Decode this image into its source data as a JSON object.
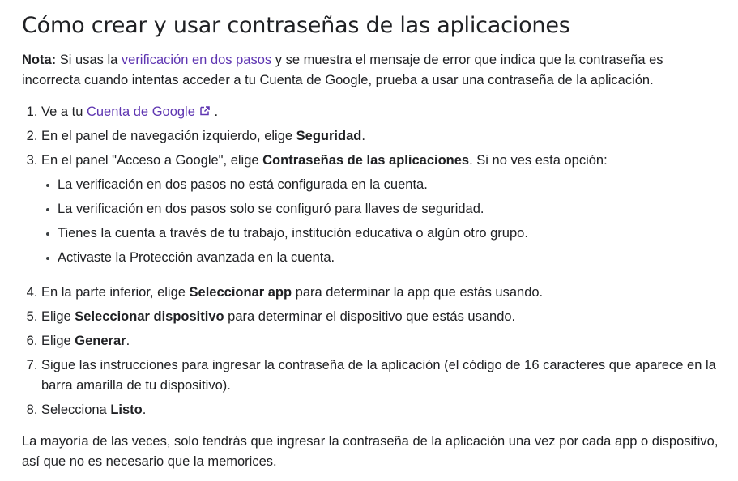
{
  "title": "Cómo crear y usar contraseñas de las aplicaciones",
  "note": {
    "label": "Nota:",
    "pre": " Si usas la ",
    "link": "verificación en dos pasos",
    "post": " y se muestra el mensaje de error que indica que la contraseña es incorrecta cuando intentas acceder a tu Cuenta de Google, prueba a usar una contraseña de la aplicación."
  },
  "steps": {
    "s1": {
      "pre": "Ve a tu ",
      "link": "Cuenta de Google",
      "post": " ."
    },
    "s2": {
      "pre": "En el panel de navegación izquierdo, elige ",
      "bold": "Seguridad",
      "post": "."
    },
    "s3": {
      "pre": "En el panel \"Acceso a Google\", elige ",
      "bold": "Contraseñas de las aplicaciones",
      "post": ". Si no ves esta opción:",
      "sub": [
        "La verificación en dos pasos no está configurada en la cuenta.",
        "La verificación en dos pasos solo se configuró para llaves de seguridad.",
        "Tienes la cuenta a través de tu trabajo, institución educativa o algún otro grupo.",
        "Activaste la Protección avanzada en la cuenta."
      ]
    },
    "s4": {
      "pre": "En la parte inferior, elige ",
      "bold": "Seleccionar app",
      "post": " para determinar la app que estás usando."
    },
    "s5": {
      "pre": "Elige ",
      "bold": "Seleccionar dispositivo",
      "post": " para determinar el dispositivo que estás usando."
    },
    "s6": {
      "pre": "Elige ",
      "bold": "Generar",
      "post": "."
    },
    "s7": {
      "text": "Sigue las instrucciones para ingresar la contraseña de la aplicación (el código de 16 caracteres que aparece en la barra amarilla de tu dispositivo)."
    },
    "s8": {
      "pre": "Selecciona ",
      "bold": "Listo",
      "post": "."
    }
  },
  "outro": "La mayoría de las veces, solo tendrás que ingresar la contraseña de la aplicación una vez por cada app o dispositivo, así que no es necesario que la memorices.",
  "icons": {
    "external_link": "external-link-icon"
  },
  "colors": {
    "link": "#5e35b1",
    "text": "#202124"
  }
}
